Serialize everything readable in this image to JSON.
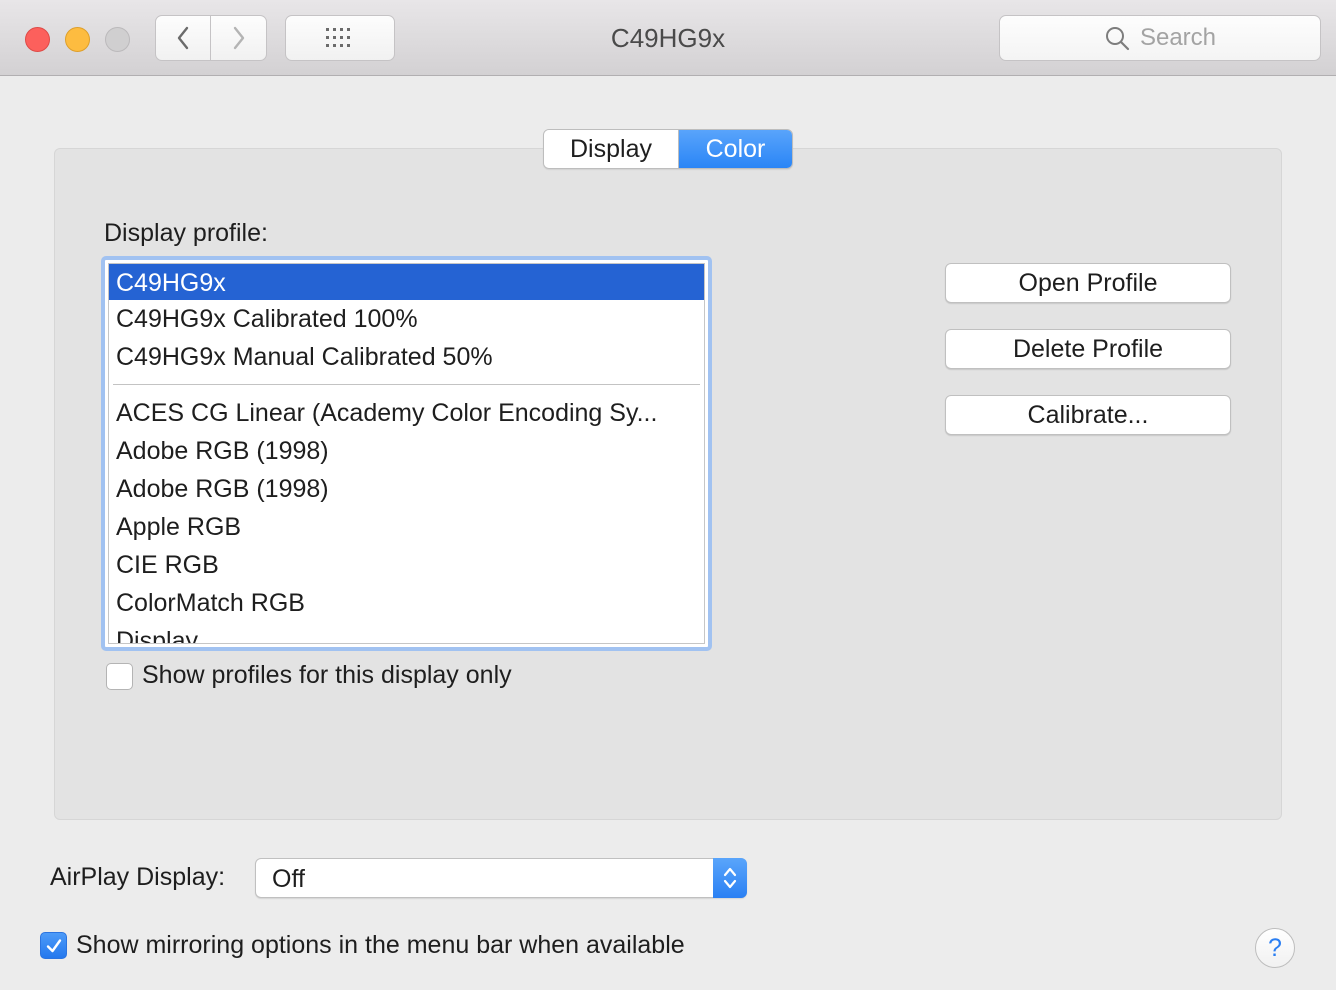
{
  "window": {
    "title": "C49HG9x",
    "search_placeholder": "Search"
  },
  "tabs": [
    {
      "label": "Display",
      "selected": false
    },
    {
      "label": "Color",
      "selected": true
    }
  ],
  "profile": {
    "label": "Display profile:",
    "items": [
      "C49HG9x",
      "C49HG9x Calibrated 100%",
      "C49HG9x Manual Calibrated 50%",
      "ACES CG Linear (Academy Color Encoding Sy...",
      "Adobe RGB (1998)",
      "Adobe RGB (1998)",
      "Apple RGB",
      "CIE RGB",
      "ColorMatch RGB",
      "Display"
    ],
    "selected_item": "C49HG9x",
    "show_only_label": "Show profiles for this display only",
    "show_only_checked": false
  },
  "buttons": {
    "open": "Open Profile",
    "delete": "Delete Profile",
    "calibrate": "Calibrate..."
  },
  "airplay": {
    "label": "AirPlay Display:",
    "value": "Off"
  },
  "mirroring": {
    "label": "Show mirroring options in the menu bar when available",
    "checked": true
  },
  "help": "?",
  "colors": {
    "accent": "#2a85f6",
    "selection": "#2563d3",
    "close": "#fc605c",
    "minimize": "#fdbc40"
  },
  "icons": [
    "chevron-left-icon",
    "chevron-right-icon",
    "grid-icon",
    "search-icon",
    "checkmark-icon",
    "up-down-arrows-icon"
  ]
}
